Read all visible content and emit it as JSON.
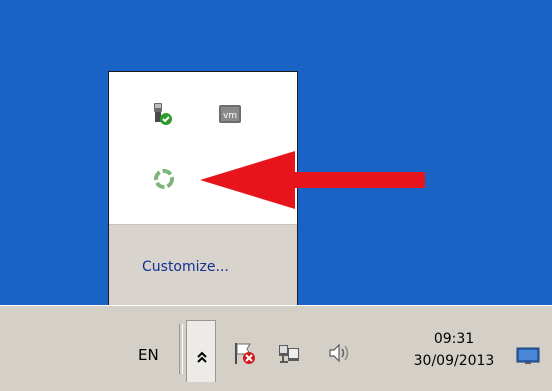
{
  "popup": {
    "customize_label": "Customize...",
    "icons": [
      {
        "name": "usb-safe-remove-icon"
      },
      {
        "name": "vmware-tools-icon",
        "text": "vm"
      },
      {
        "name": "sync-icon"
      }
    ]
  },
  "annotation": {
    "arrow_color": "#e8141c"
  },
  "taskbar": {
    "language": "EN",
    "overflow_glyph": "⌃",
    "tray_icons": [
      {
        "name": "action-center-flag-icon"
      },
      {
        "name": "network-icon"
      },
      {
        "name": "volume-icon"
      }
    ],
    "clock": {
      "time": "09:31",
      "date": "30/09/2013"
    }
  },
  "colors": {
    "desktop": "#1a63c6",
    "taskbar": "#d4d0c8",
    "popup_footer": "#d8d4cd",
    "link": "#0f2f8f"
  }
}
